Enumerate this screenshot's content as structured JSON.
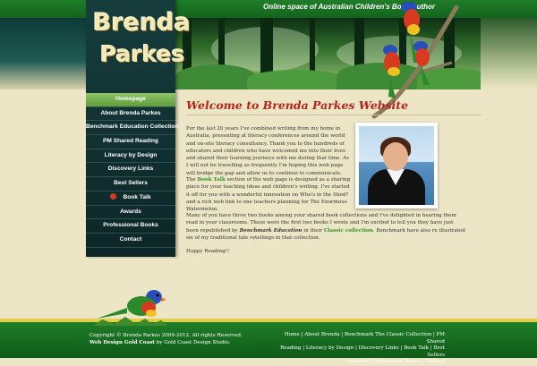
{
  "header": {
    "tagline": "Online space of Australian Children's Book Author",
    "logo_line1": "Brenda",
    "logo_line2": "Parkes"
  },
  "nav": {
    "items": [
      {
        "label": "Homepage",
        "active": true
      },
      {
        "label": "About Brenda Parkes"
      },
      {
        "label": "Benchmark Education Collection"
      },
      {
        "label": "PM Shared Reading"
      },
      {
        "label": "Literacy by Design"
      },
      {
        "label": "Discovery Links"
      },
      {
        "label": "Best Sellers"
      },
      {
        "label": "Book Talk",
        "icon": "apple-icon"
      },
      {
        "label": "Awards"
      },
      {
        "label": "Professional Books"
      },
      {
        "label": "Contact"
      }
    ]
  },
  "main": {
    "title": "Welcome to Brenda Parkes Website",
    "para1": "For the last 20 years I've combined writing from my home in Australia, presenting at literacy conferences around the world and on-site literacy consultancy. Thank you to the hundreds of educators and children who have welcomed me into their lives and shared their learning journeys with me during that time. As I will not be travelling as frequently I'm hoping this web page will bridge the gap and allow us to continue to communicate.",
    "para2_pre": "The ",
    "para2_link": "Book Talk",
    "para2_post": " section of the web page is designed as a sharing place for your teaching ideas and children's writing. I've started it off for you with a wonderful innovation on Who's in the Shed? and a rich web link to one teachers planning for The Enormous Watermelon.",
    "para3_pre": "Many of you have three two books among your shared book collections and I've delighted in hearing them read in your classrooms. These were the first two books I wrote and I'm excited to tell you they have just been republished by ",
    "para3_bold": "Benchmark Education",
    "para3_mid": " in their ",
    "para3_link": "Classic collection",
    "para3_post": ". Benchmark have also re illustrated six of my traditional tale retellings in that collection.",
    "closing": "Happy Reading!!"
  },
  "footer": {
    "copyright": "Copyright © Brenda Parkes 2009-2012. All rights Reserved.",
    "credit_bold": "Web Design Gold Coast",
    "credit_rest": " by Gold Coast Design Studio.",
    "links_line1": "Home | About Brenda | Benchmark The Classic Collection | PM Shared",
    "links_line2": "Reading | Literacy by Design | Discovery Links | Book Talk | Best Sellers",
    "links_line3": "| Awards | Professional Books | Contact"
  },
  "colors": {
    "accent_green": "#2f8f2a",
    "title_red": "#b3241b",
    "nav_bg": "#163d3c",
    "page_bg": "#ede6c6"
  }
}
